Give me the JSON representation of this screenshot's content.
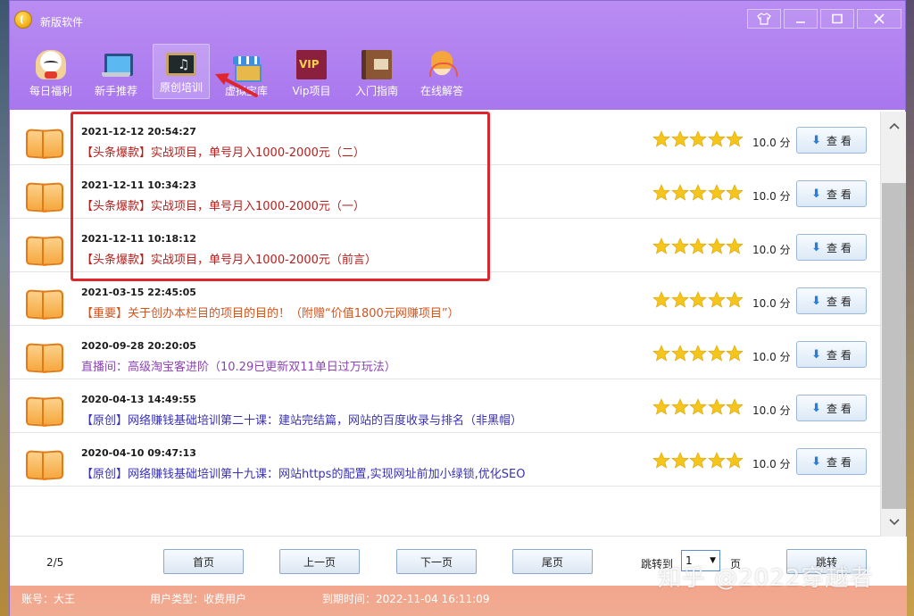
{
  "window": {
    "title": "新版软件"
  },
  "toolbar": [
    {
      "label": "每日福利",
      "icon": "lucky-cat-icon",
      "active": false
    },
    {
      "label": "新手推荐",
      "icon": "laptop-icon",
      "active": false
    },
    {
      "label": "原创培训",
      "icon": "blackboard-icon",
      "active": true
    },
    {
      "label": "虚拟宝库",
      "icon": "store-icon",
      "active": false
    },
    {
      "label": "Vip项目",
      "icon": "vip-icon",
      "active": false
    },
    {
      "label": "入门指南",
      "icon": "book-guide-icon",
      "active": false
    },
    {
      "label": "在线解答",
      "icon": "customer-service-icon",
      "active": false
    }
  ],
  "items": [
    {
      "date": "2021-12-12 20:54:27",
      "title": "【头条爆款】实战项目，单号月入1000-2000元（二）",
      "color": "#b2221f",
      "rating": 5,
      "score": "10.0 分",
      "view_label": "查 看"
    },
    {
      "date": "2021-12-11 10:34:23",
      "title": "【头条爆款】实战项目，单号月入1000-2000元（一）",
      "color": "#b2221f",
      "rating": 5,
      "score": "10.0 分",
      "view_label": "查 看"
    },
    {
      "date": "2021-12-11 10:18:12",
      "title": "【头条爆款】实战项目，单号月入1000-2000元（前言）",
      "color": "#b2221f",
      "rating": 5,
      "score": "10.0 分",
      "view_label": "查 看"
    },
    {
      "date": "2021-03-15 22:45:05",
      "title": "【重要】关于创办本栏目的项目的目的！（附赠“价值1800元网赚项目”）",
      "color": "#d2541f",
      "rating": 5,
      "score": "10.0 分",
      "view_label": "查 看"
    },
    {
      "date": "2020-09-28 20:20:05",
      "title": "直播间：高级淘宝客进阶（10.29已更新双11单日过万玩法）",
      "color": "#8c44b4",
      "rating": 5,
      "score": "10.0 分",
      "view_label": "查 看"
    },
    {
      "date": "2020-04-13 14:49:55",
      "title": "【原创】网络赚钱基础培训第二十课：建站完结篇，网站的百度收录与排名（非黑帽）",
      "color": "#3a31b6",
      "rating": 5,
      "score": "10.0 分",
      "view_label": "查 看"
    },
    {
      "date": "2020-04-10 09:47:13",
      "title": "【原创】网络赚钱基础培训第十九课：网站https的配置,实现网址前加小绿锁,优化SEO",
      "color": "#3a31b6",
      "rating": 5,
      "score": "10.0 分",
      "view_label": "查 看"
    }
  ],
  "pager": {
    "page_info": "2/5",
    "first": "首页",
    "prev": "上一页",
    "next": "下一页",
    "last": "尾页",
    "jump_label": "跳转到",
    "jump_value": "1",
    "page_unit": "页",
    "jump_button": "跳转"
  },
  "status": {
    "account": "账号：大王",
    "user_type": "用户类型：收费用户",
    "expiry": "到期时间：2022-11-04 16:11:09"
  },
  "watermark": "知乎 @2022穿越者",
  "colors": {
    "header": "#a877ee",
    "highlight": "#e0262d",
    "star": "#f6c51b",
    "status_bar": "#f0a88e"
  }
}
